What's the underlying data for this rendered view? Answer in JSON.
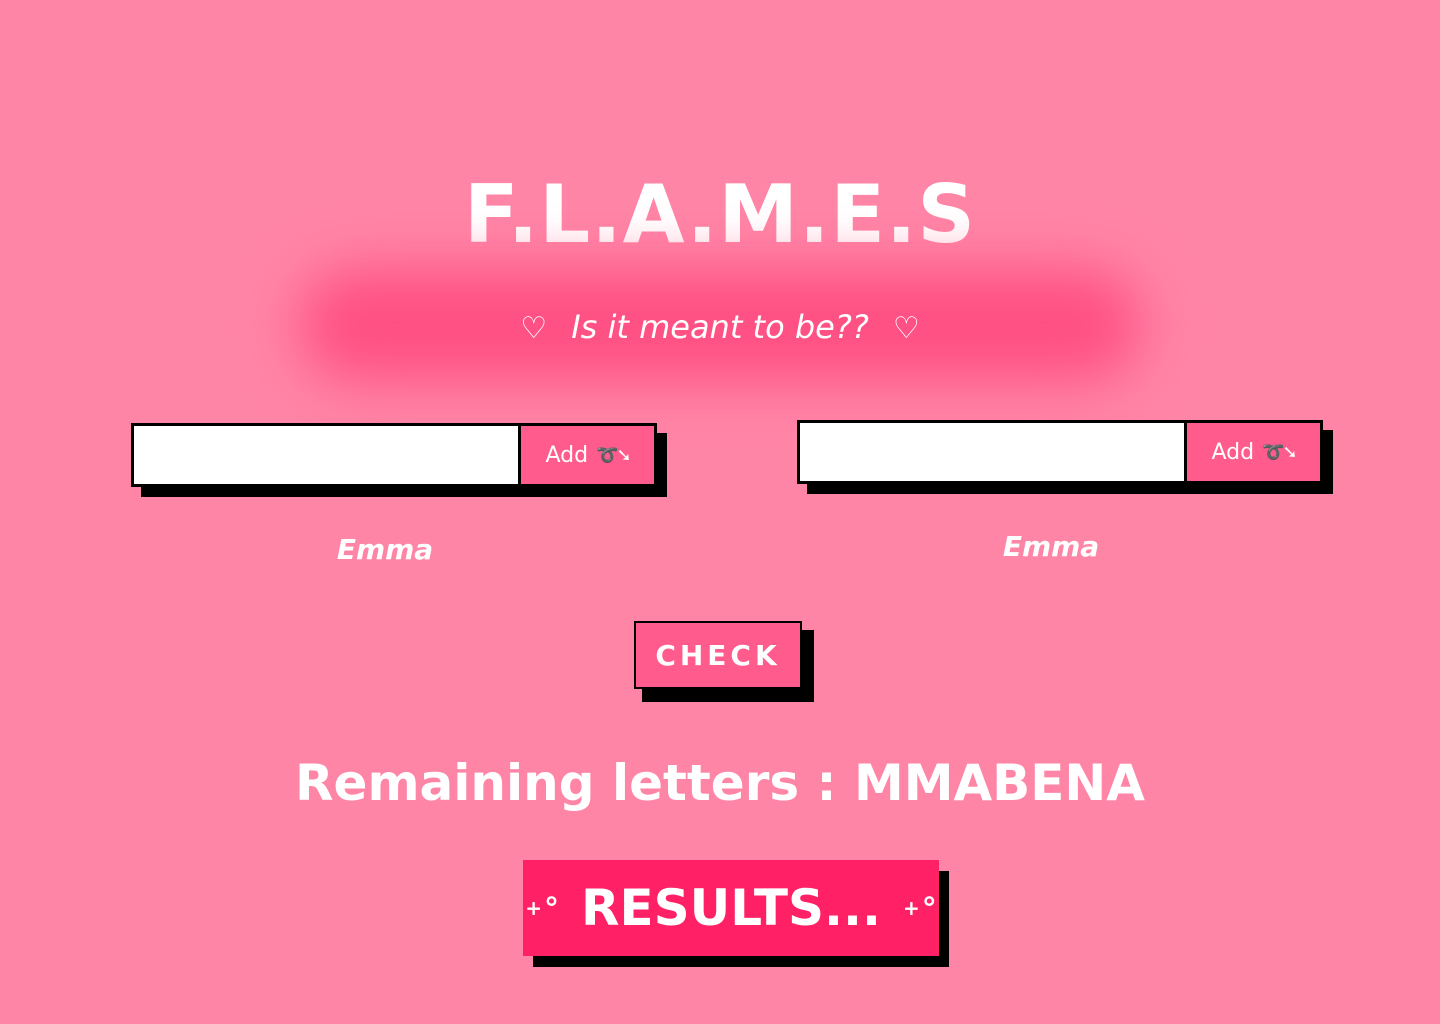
{
  "header": {
    "title": "F.L.A.M.E.S",
    "tagline": "Is it meant to be??",
    "heart_glyph": "♡"
  },
  "name_inputs": [
    {
      "value": "",
      "add_label": "Add",
      "add_icon": "arrow-icon",
      "display_name": "Emma"
    },
    {
      "value": "",
      "add_label": "Add",
      "add_icon": "arrow-icon",
      "display_name": "Emma"
    }
  ],
  "check_button": {
    "label": "CHECK"
  },
  "remaining": {
    "text": "Remaining letters : MMABENA"
  },
  "results_button": {
    "label": "RESULTS...",
    "icon": "sparkle-icon"
  },
  "colors": {
    "background": "#ff85a6",
    "accent": "#ff5c8d",
    "results": "#ff2066",
    "glow": "#ff4f82"
  }
}
